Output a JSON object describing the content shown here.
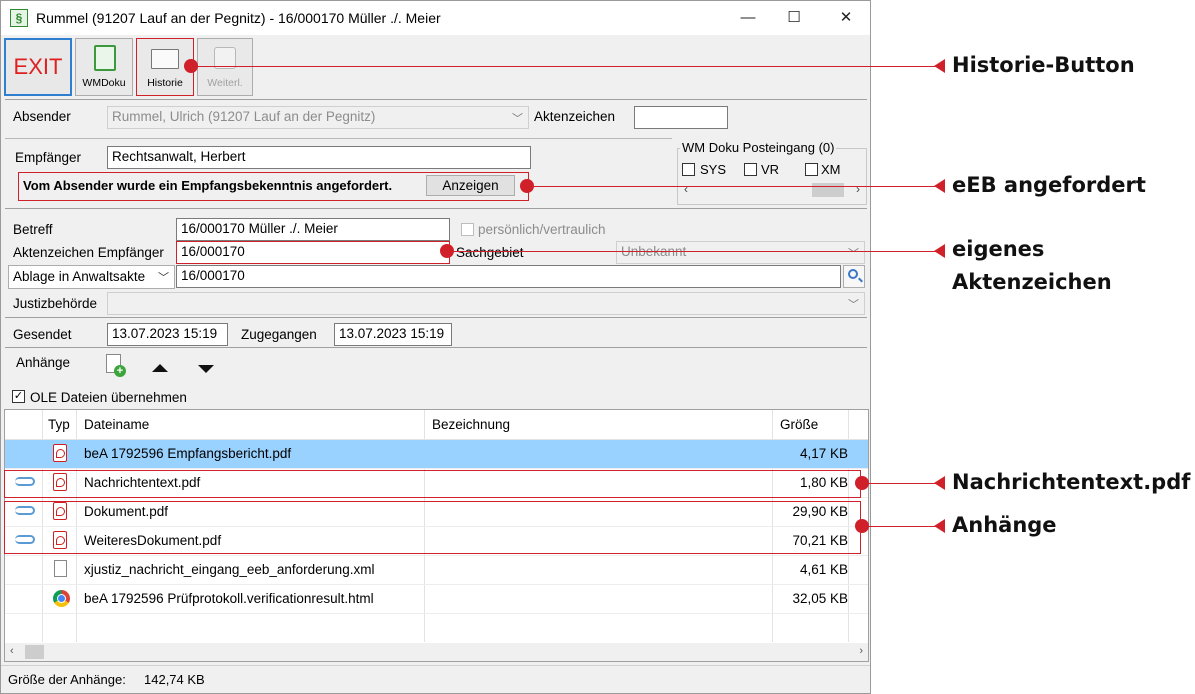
{
  "window": {
    "title": "Rummel (91207 Lauf an der Pegnitz) - 16/000170 Müller ./. Meier",
    "minimize": "—",
    "maximize": "☐",
    "close": "✕"
  },
  "toolbar": {
    "exit_label": "EXIT",
    "wmdoku_label": "WMDoku",
    "historie_label": "Historie",
    "weiterl_label": "Weiterl."
  },
  "sender": {
    "label": "Absender",
    "value": "Rummel, Ulrich (91207 Lauf an der Pegnitz)",
    "aktenzeichen_label": "Aktenzeichen",
    "aktenzeichen_value": ""
  },
  "recipient": {
    "label": "Empfänger",
    "value": "Rechtsanwalt, Herbert",
    "eeb_notice": "Vom Absender wurde ein Empfangsbekenntnis angefordert.",
    "show_button": "Anzeigen"
  },
  "wm_doku": {
    "title": "WM Doku Posteingang (0)",
    "options": [
      "SYS",
      "VR",
      "XM"
    ]
  },
  "meta": {
    "betreff_label": "Betreff",
    "betreff_value": "16/000170 Müller ./. Meier",
    "persoenlich_label": "persönlich/vertraulich",
    "az_empfaenger_label": "Aktenzeichen Empfänger",
    "az_empfaenger_value": "16/000170",
    "sachgebiet_label": "Sachgebiet",
    "sachgebiet_value": "Unbekannt",
    "ablage_label": "Ablage in Anwaltsakte",
    "ablage_value": "16/000170",
    "justiz_label": "Justizbehörde",
    "justiz_value": ""
  },
  "dates": {
    "gesendet_label": "Gesendet",
    "gesendet_value": "13.07.2023 15:19",
    "zugegangen_label": "Zugegangen",
    "zugegangen_value": "13.07.2023 15:19"
  },
  "attachments": {
    "label": "Anhänge",
    "ole_label": "OLE Dateien übernehmen",
    "ole_checked": true,
    "columns": [
      "Typ",
      "Dateiname",
      "Bezeichnung",
      "Größe"
    ],
    "rows": [
      {
        "icon": "pdf-icon",
        "clip": false,
        "name": "beA 1792596 Empfangsbericht.pdf",
        "description": "",
        "size": "4,17 KB",
        "selected": true
      },
      {
        "icon": "pdf-icon",
        "clip": true,
        "name": "Nachrichtentext.pdf",
        "description": "",
        "size": "1,80 KB",
        "selected": false
      },
      {
        "icon": "pdf-icon",
        "clip": true,
        "name": "Dokument.pdf",
        "description": "",
        "size": "29,90 KB",
        "selected": false
      },
      {
        "icon": "pdf-icon",
        "clip": true,
        "name": "WeiteresDokument.pdf",
        "description": "",
        "size": "70,21 KB",
        "selected": false
      },
      {
        "icon": "file-icon",
        "clip": false,
        "name": "xjustiz_nachricht_eingang_eeb_anforderung.xml",
        "description": "",
        "size": "4,61 KB",
        "selected": false
      },
      {
        "icon": "chrome-icon",
        "clip": false,
        "name": "beA 1792596 Prüfprotokoll.verificationresult.html",
        "description": "",
        "size": "32,05 KB",
        "selected": false
      }
    ]
  },
  "status": {
    "size_label": "Größe der Anhänge:",
    "size_value": "142,74 KB"
  },
  "annotations": {
    "historie": "Historie-Button",
    "eeb": "eEB angefordert",
    "aktenzeichen_line1": "eigenes",
    "aktenzeichen_line2": "Aktenzeichen",
    "nachrichtentext": "Nachrichtentext.pdf",
    "anhaenge": "Anhänge"
  },
  "colors": {
    "annotation_red": "#d0202a",
    "selection_blue": "#99d1ff",
    "exit_red": "#e02020"
  }
}
